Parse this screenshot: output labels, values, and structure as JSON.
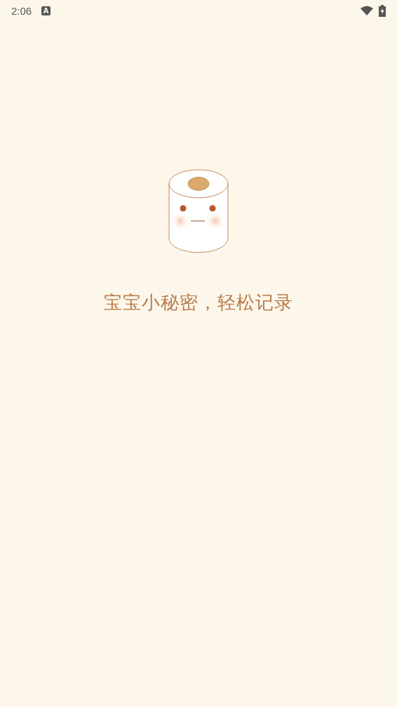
{
  "status_bar": {
    "time": "2:06",
    "notification_glyph": "A"
  },
  "splash": {
    "tagline": "宝宝小秘密，轻松记录"
  }
}
